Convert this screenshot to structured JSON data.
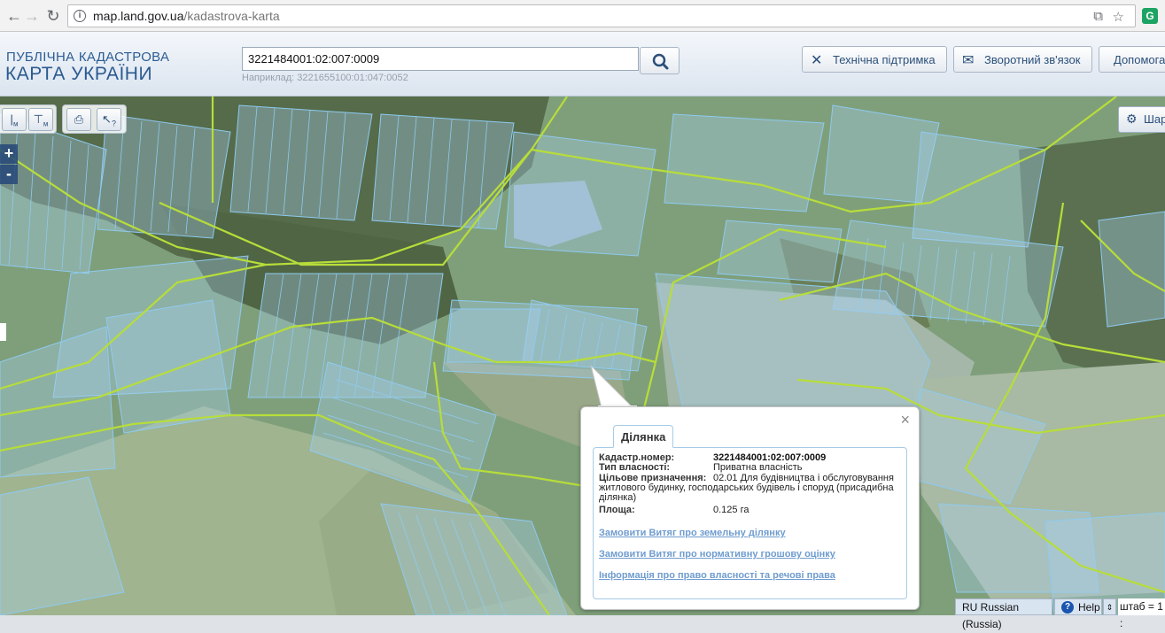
{
  "browser": {
    "url_host": "map.land.gov.ua",
    "url_path": "/kadastrova-karta"
  },
  "header": {
    "brand_line1": "ПУБЛІЧНА КАДАСТРОВА",
    "brand_line2": "КАРТА УКРАЇНИ",
    "search_value": "3221484001:02:007:0009",
    "search_hint": "Наприклад: 3221655100:01:047:0052",
    "buttons": {
      "support": "Технічна підтримка",
      "feedback": "Зворотний зв'язок",
      "help": "Допомога"
    }
  },
  "map": {
    "tools": {
      "measure_line_sub": "м",
      "measure_area_sub": "м",
      "identify": "?"
    },
    "zoom_in": "+",
    "zoom_out": "-",
    "basemap_label": "Шар"
  },
  "popup": {
    "tab_title": "Ділянка",
    "fields": {
      "cadastral_label": "Кадастр.номер:",
      "cadastral_value": "3221484001:02:007:0009",
      "ownership_label": "Тип власності:",
      "ownership_value": "Приватна власність",
      "purpose_label": "Цільове призначення:",
      "purpose_value": "02.01 Для будівництва і обслуговування житлового будинку, господарських будівель і споруд (присадибна ділянка)",
      "area_label": "Площа:",
      "area_value": "0.125 га"
    },
    "links": {
      "order_extract": "Замовити Витяг про земельну ділянку",
      "order_valuation": "Замовити Витяг про нормативну грошову оцінку",
      "ownership_info": "Інформація про право власності та речові права"
    }
  },
  "status_bar": {
    "language": "RU Russian (Russia)",
    "help": "Help",
    "scale": "штаб = 1 :"
  }
}
